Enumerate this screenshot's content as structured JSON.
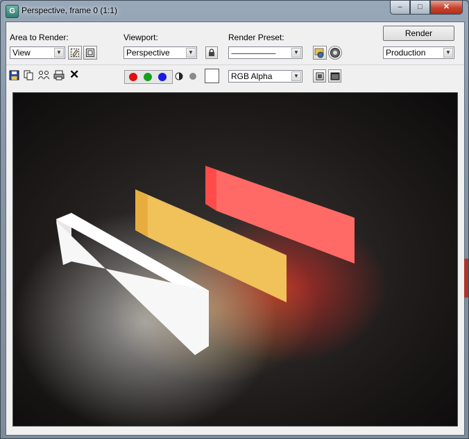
{
  "window": {
    "title": "Perspective, frame 0 (1:1)",
    "app_icon_letter": "G",
    "minimize_glyph": "–",
    "maximize_glyph": "□",
    "close_glyph": "✕"
  },
  "area_to_render": {
    "label": "Area to Render:",
    "value": "View"
  },
  "viewport": {
    "label": "Viewport:",
    "value": "Perspective"
  },
  "render_preset": {
    "label": "Render Preset:",
    "value": "--------------------------------"
  },
  "render_button": {
    "label": "Render"
  },
  "render_mode": {
    "value": "Production"
  },
  "channel": {
    "value": "RGB Alpha"
  },
  "icons": {
    "save": "save-icon",
    "copy": "copy-image-icon",
    "clone": "clone-window-icon",
    "print": "print-icon",
    "clear": "clear-icon",
    "red": "red-channel-icon",
    "green": "green-channel-icon",
    "blue": "blue-channel-icon",
    "mono": "monochrome-icon",
    "alpha": "alpha-channel-icon"
  },
  "colors": {
    "red_channel": "#e01010",
    "green_channel": "#14a01e",
    "blue_channel": "#1a1ae0",
    "render_background": "#141212",
    "white_bar": "#f7f7f7",
    "yellow_bar": "#f1c15a",
    "red_bar": "#ff6a66"
  }
}
